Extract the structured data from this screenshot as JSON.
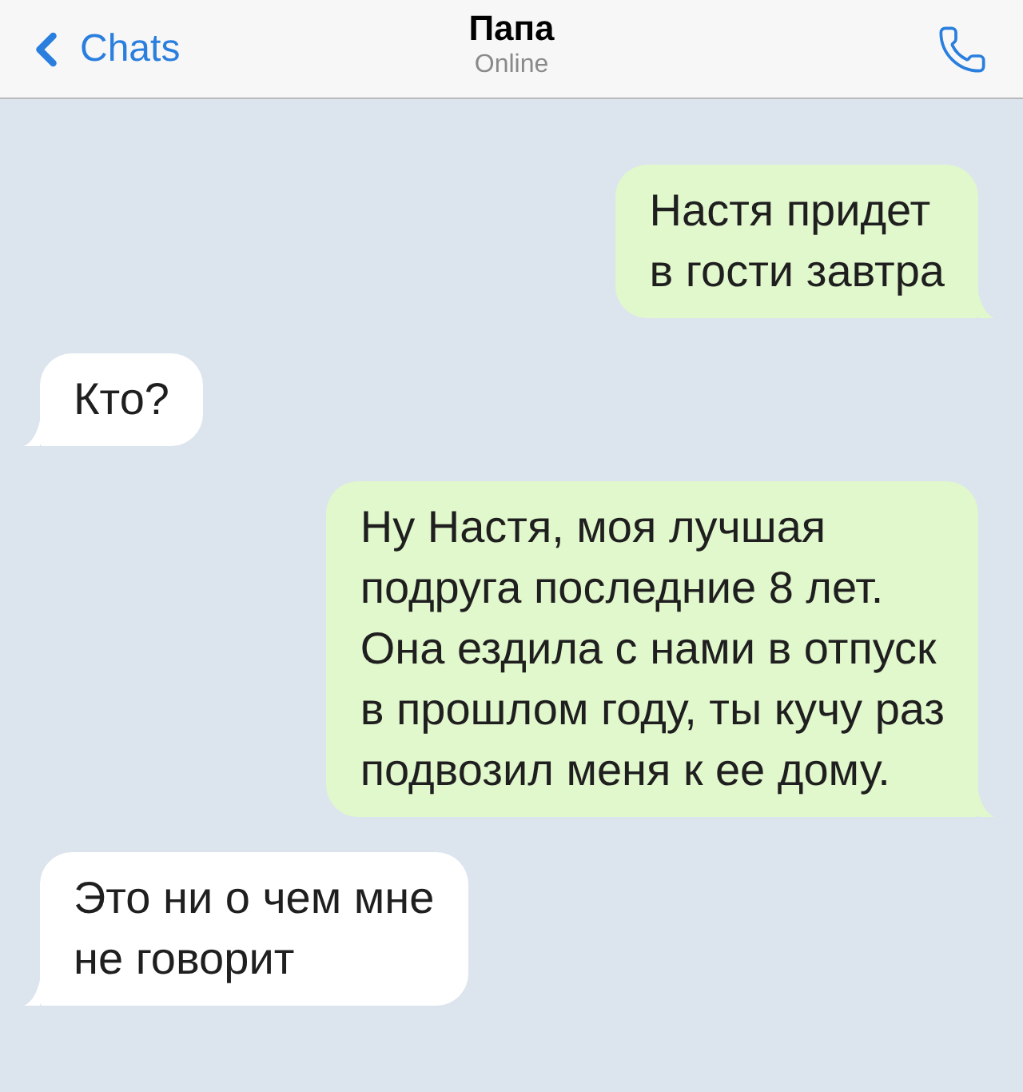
{
  "header": {
    "back": {
      "label": "Chats"
    },
    "title": "Папа",
    "status": "Online"
  },
  "messages": [
    {
      "kind": "outgoing",
      "text": "Настя придет\nв гости завтра"
    },
    {
      "kind": "incoming",
      "text": "Кто?"
    },
    {
      "kind": "outgoing",
      "text": "Ну Настя, моя лучшая\nподруга последние 8 лет.\nОна ездила с нами в отпуск\nв прошлом году, ты кучу раз\nподвозил меня к ее дому."
    },
    {
      "kind": "incoming",
      "text": "Это ни о чем мне\nне говорит"
    }
  ]
}
